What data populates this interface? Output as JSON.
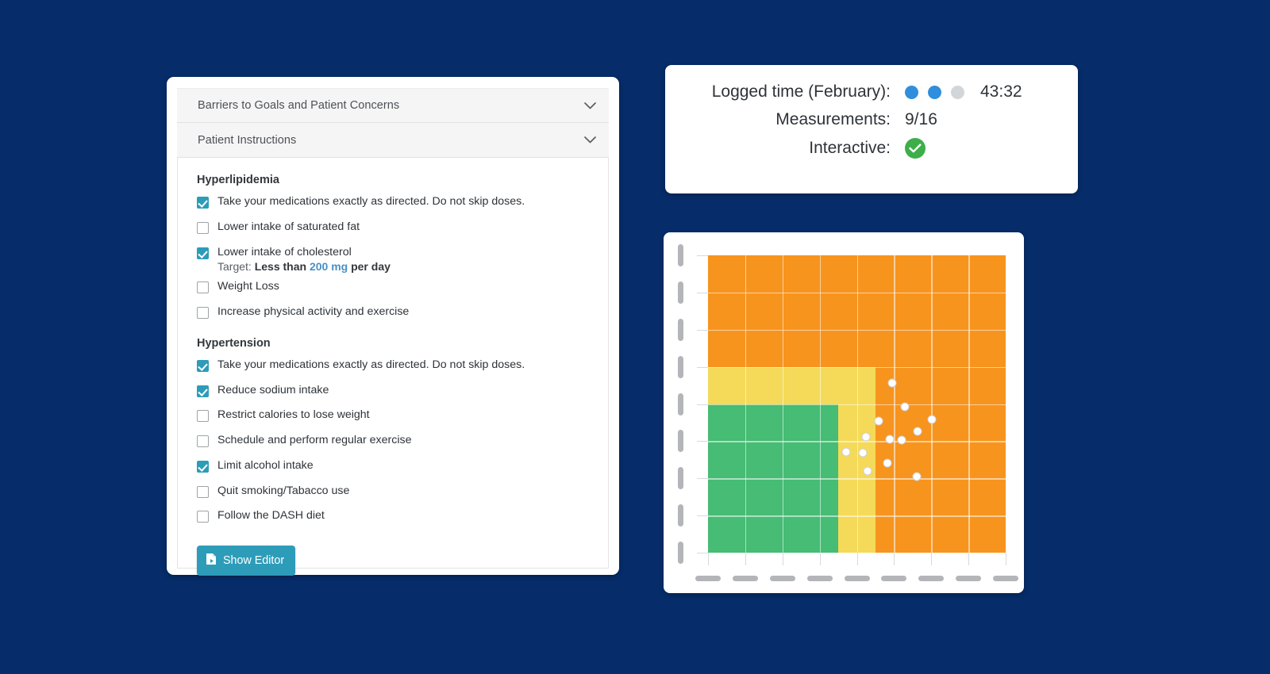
{
  "theme": {
    "background": "#062c69",
    "accent_teal": "#2d9cb9",
    "link_blue": "#4a90c4",
    "zone_green": "#46bc74",
    "zone_yellow": "#f4da58",
    "zone_orange": "#f7941e",
    "dot_blue": "#2f8fdc",
    "dot_gray": "#d3d6d9",
    "check_green": "#3eae4a"
  },
  "accordions": [
    {
      "label": "Barriers to Goals and Patient Concerns",
      "icon": "chevron-down-icon",
      "expanded": false
    },
    {
      "label": "Patient Instructions",
      "icon": "chevron-down-icon",
      "expanded": true
    }
  ],
  "instructions": {
    "groups": [
      {
        "title": "Hyperlipidemia",
        "items": [
          {
            "label": "Take your medications exactly as directed. Do not skip doses.",
            "checked": true
          },
          {
            "label": "Lower intake of saturated fat",
            "checked": false
          },
          {
            "label": "Lower intake of cholesterol",
            "checked": true,
            "target": {
              "prefix": "Target:",
              "bold_before": "Less than",
              "value": "200 mg",
              "bold_after": "per day"
            }
          },
          {
            "label": "Weight Loss",
            "checked": false
          },
          {
            "label": "Increase physical activity and exercise",
            "checked": false
          }
        ]
      },
      {
        "title": "Hypertension",
        "items": [
          {
            "label": "Take your medications exactly as directed. Do not skip doses.",
            "checked": true
          },
          {
            "label": "Reduce sodium intake",
            "checked": true
          },
          {
            "label": "Restrict calories to lose weight",
            "checked": false
          },
          {
            "label": "Schedule and perform regular exercise",
            "checked": false
          },
          {
            "label": "Limit alcohol intake",
            "checked": true
          },
          {
            "label": "Quit smoking/Tabacco use",
            "checked": false
          },
          {
            "label": "Follow the DASH diet",
            "checked": false
          }
        ]
      }
    ],
    "show_editor_label": "Show Editor",
    "show_editor_icon": "document-icon"
  },
  "stats": {
    "rows": [
      {
        "label": "Logged time (February):",
        "type": "dots-value",
        "dots": [
          "filled",
          "filled",
          "empty"
        ],
        "value": "43:32"
      },
      {
        "label": "Measurements:",
        "type": "value",
        "value": "9/16"
      },
      {
        "label": "Interactive:",
        "type": "check",
        "icon": "green-check-icon"
      }
    ]
  },
  "chart_data": {
    "type": "scatter",
    "title": "",
    "xlabel": "",
    "ylabel": "",
    "xlim": [
      0,
      8
    ],
    "ylim": [
      0,
      8
    ],
    "grid": true,
    "legend": "none",
    "x_tick_labels": [
      "",
      "",
      "",
      "",
      "",
      "",
      "",
      "",
      ""
    ],
    "y_tick_labels": [
      "",
      "",
      "",
      "",
      "",
      "",
      "",
      "",
      ""
    ],
    "axis_labels_hidden": true,
    "zones": [
      {
        "name": "orange-zone",
        "color": "#f7941e",
        "x0": 0,
        "x1": 8,
        "y0": 0,
        "y1": 8
      },
      {
        "name": "yellow-zone",
        "color": "#f4da58",
        "x0": 0,
        "x1": 4.5,
        "y0": 0,
        "y1": 5
      },
      {
        "name": "green-zone",
        "color": "#46bc74",
        "x0": 0,
        "x1": 3.5,
        "y0": 0,
        "y1": 4
      }
    ],
    "points": [
      {
        "x": 4.95,
        "y": 4.57
      },
      {
        "x": 5.3,
        "y": 3.92
      },
      {
        "x": 6.02,
        "y": 3.58
      },
      {
        "x": 4.58,
        "y": 3.55
      },
      {
        "x": 5.63,
        "y": 3.27
      },
      {
        "x": 4.25,
        "y": 3.12
      },
      {
        "x": 4.88,
        "y": 3.05
      },
      {
        "x": 5.2,
        "y": 3.03
      },
      {
        "x": 3.72,
        "y": 2.7
      },
      {
        "x": 4.17,
        "y": 2.68
      },
      {
        "x": 4.82,
        "y": 2.42
      },
      {
        "x": 4.28,
        "y": 2.2
      },
      {
        "x": 5.62,
        "y": 2.05
      }
    ],
    "point_count": 13,
    "point_color": "#ffffff"
  }
}
